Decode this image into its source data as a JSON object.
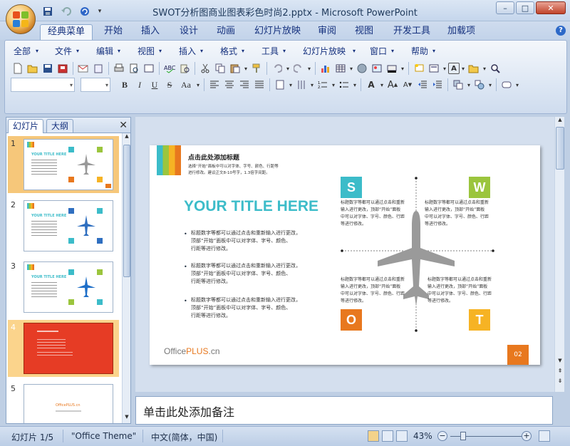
{
  "window": {
    "title": "SWOT分析图商业图表彩色时尚2.pptx - Microsoft PowerPoint",
    "controls": [
      "–",
      "□",
      "✕"
    ]
  },
  "ribbon_tabs": [
    "经典菜单",
    "开始",
    "插入",
    "设计",
    "动画",
    "幻灯片放映",
    "审阅",
    "视图",
    "开发工具",
    "加载项"
  ],
  "classic_menu": [
    "全部",
    "文件",
    "编辑",
    "视图",
    "插入",
    "格式",
    "工具",
    "幻灯片放映",
    "窗口",
    "帮助"
  ],
  "pane": {
    "tabs": [
      "幻灯片",
      "大纲"
    ],
    "slide_numbers": [
      "1",
      "2",
      "3",
      "4",
      "5"
    ],
    "thumb5_text": "OfficePLUS.cn"
  },
  "slide": {
    "header_title": "点击此处添加标题",
    "header_sub1": "选择“开始”面板中可以对字体、字号、颜色、行距等",
    "header_sub2": "进行修改。建议正文8-10号字，1.3倍字间距。",
    "main_title": "YOUR TITLE HERE",
    "bullets": [
      [
        "标题数字等都可以通过点击和重新输入进行更改，",
        "顶部“开始”面板中可以对字体、字号、颜色、",
        "行距等进行修改。"
      ],
      [
        "标题数字等都可以通过点击和重新输入进行更改，",
        "顶部“开始”面板中可以对字体、字号、颜色、",
        "行距等进行修改。"
      ],
      [
        "标题数字等都可以通过点击和重新输入进行更改，",
        "顶部“开始”面板中可以对字体、字号、颜色、",
        "行距等进行修改。"
      ]
    ],
    "swot": {
      "S": {
        "letter": "S",
        "color": "#3cbcc9",
        "text": [
          "标题数字等都可以通过点击和重新",
          "输入进行更改，顶部“开始”面板",
          "中可以对字体、字号、颜色、行距",
          "等进行修改。"
        ]
      },
      "W": {
        "letter": "W",
        "color": "#9bc53d",
        "text": [
          "标题数字等都可以通过点击和重新",
          "输入进行更改，顶部“开始”面板",
          "中可以对字体、字号、颜色、行距",
          "等进行修改。"
        ]
      },
      "O": {
        "letter": "O",
        "color": "#e8781e",
        "text": [
          "标题数字等都可以通过点击和重新",
          "输入进行更改，顶部“开始”面板",
          "中可以对字体、字号、颜色、行距",
          "等进行修改。"
        ]
      },
      "T": {
        "letter": "T",
        "color": "#f6b324",
        "text": [
          "标题数字等都可以通过点击和重新",
          "输入进行更改，顶部“开始”面板",
          "中可以对字体、字号、颜色、行距",
          "等进行修改。"
        ]
      }
    },
    "logo_office": "Office",
    "logo_plus": "PLUS",
    "logo_cn": ".cn",
    "page_number": "02"
  },
  "notes_placeholder": "单击此处添加备注",
  "status": {
    "slide": "幻灯片 1/5",
    "theme": "\"Office Theme\"",
    "language": "中文(简体，中国)",
    "zoom": "43%"
  },
  "colors": {
    "accent_teal": "#3cbcc9",
    "accent_green": "#9bc53d",
    "accent_orange": "#e8781e",
    "accent_yellow": "#f6b324",
    "slide4_red": "#e63c25"
  }
}
